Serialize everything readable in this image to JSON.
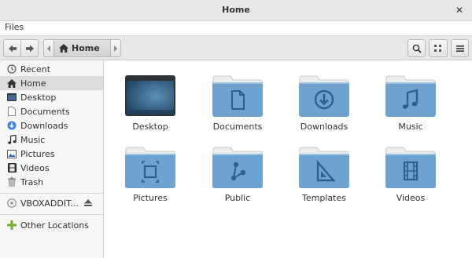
{
  "window": {
    "title": "Home"
  },
  "menubar": {
    "files_label": "Files"
  },
  "toolbar": {
    "path": {
      "current_label": "Home"
    },
    "icons": [
      "back-arrow-icon",
      "forward-arrow-icon",
      "home-icon",
      "search-icon",
      "grid-view-icon",
      "hamburger-menu-icon"
    ]
  },
  "sidebar": {
    "items": [
      {
        "label": "Recent",
        "icon": "clock-icon"
      },
      {
        "label": "Home",
        "icon": "home-icon",
        "selected": true
      },
      {
        "label": "Desktop",
        "icon": "desktop-icon"
      },
      {
        "label": "Documents",
        "icon": "document-icon"
      },
      {
        "label": "Downloads",
        "icon": "download-icon"
      },
      {
        "label": "Music",
        "icon": "music-icon"
      },
      {
        "label": "Pictures",
        "icon": "picture-icon"
      },
      {
        "label": "Videos",
        "icon": "video-icon"
      },
      {
        "label": "Trash",
        "icon": "trash-icon"
      }
    ],
    "device": {
      "label": "VBOXADDIT...",
      "icon": "disc-icon",
      "eject_icon": "eject-icon"
    },
    "other": {
      "label": "Other Locations",
      "icon": "plus-icon"
    }
  },
  "main": {
    "folders": [
      {
        "label": "Desktop",
        "icon": "desktop-folder-icon"
      },
      {
        "label": "Documents",
        "icon": "documents-folder-icon"
      },
      {
        "label": "Downloads",
        "icon": "downloads-folder-icon"
      },
      {
        "label": "Music",
        "icon": "music-folder-icon"
      },
      {
        "label": "Pictures",
        "icon": "pictures-folder-icon"
      },
      {
        "label": "Public",
        "icon": "public-folder-icon"
      },
      {
        "label": "Templates",
        "icon": "templates-folder-icon"
      },
      {
        "label": "Videos",
        "icon": "videos-folder-icon"
      }
    ]
  },
  "colors": {
    "folder": "#6ea2cf",
    "folder_tab": "#eeeeec",
    "selection": "#dcdcda",
    "toolbar": "#e8e8e7"
  }
}
